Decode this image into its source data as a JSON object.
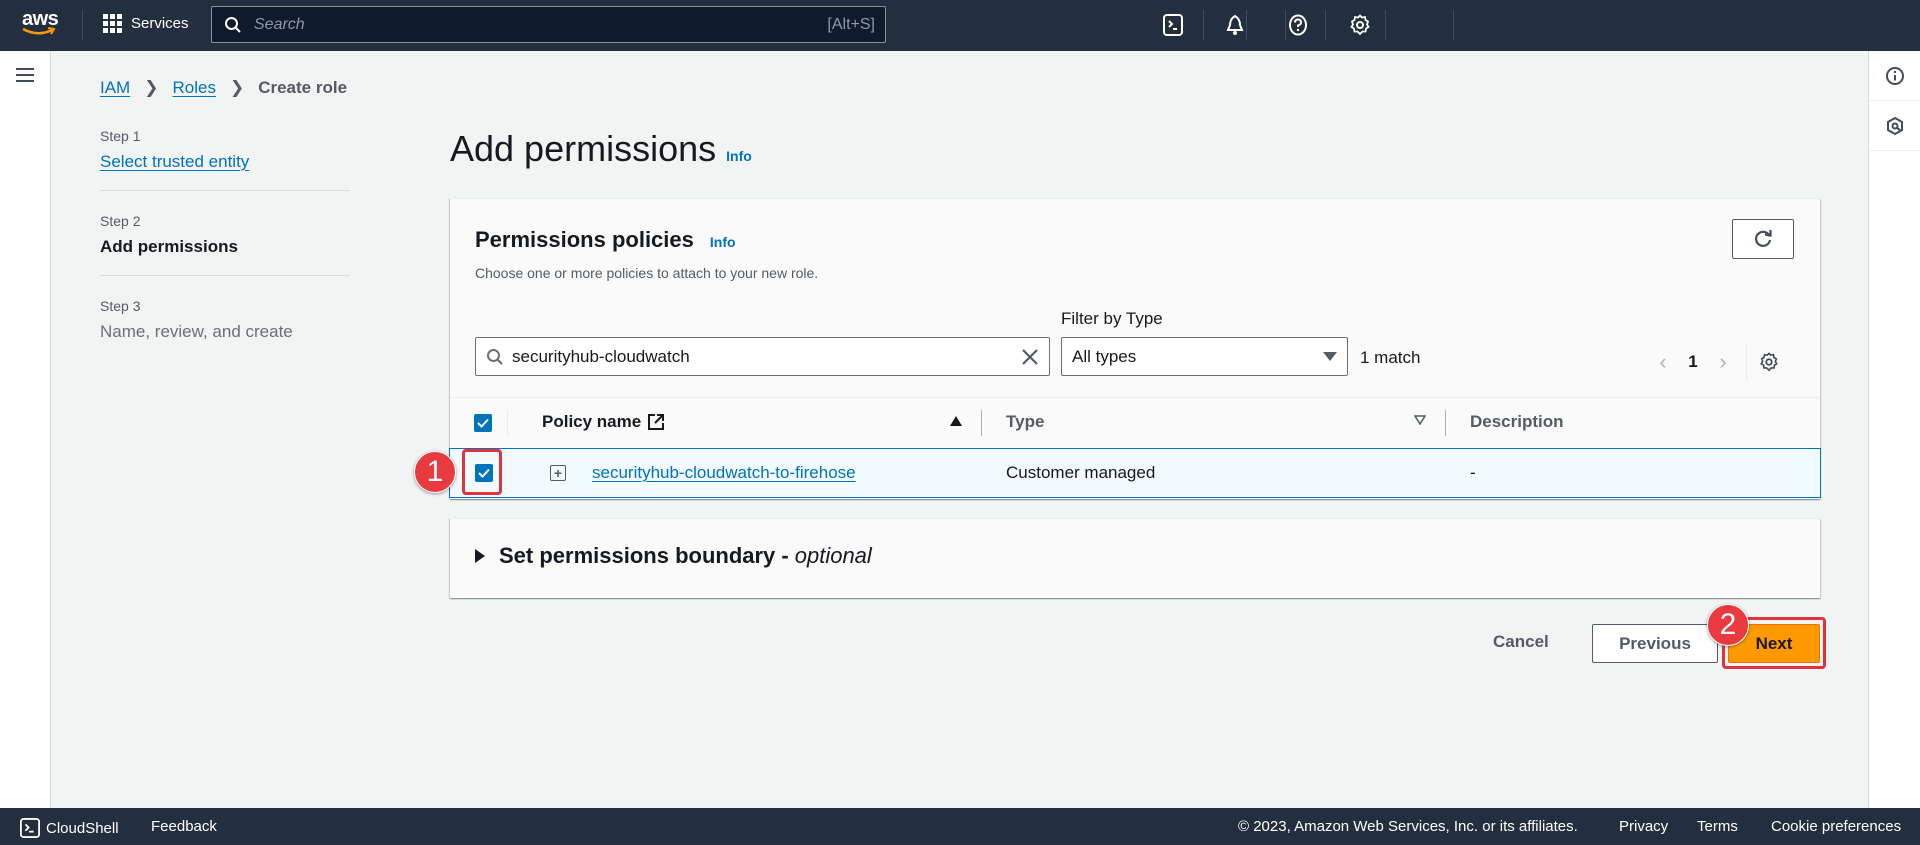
{
  "topnav": {
    "logo_text": "aws",
    "services_label": "Services",
    "search_placeholder": "Search",
    "search_shortcut": "[Alt+S]",
    "icons": [
      "cloudshell-icon",
      "notifications-bell-icon",
      "help-icon",
      "settings-gear-icon"
    ]
  },
  "breadcrumb": [
    {
      "label": "IAM",
      "link": true
    },
    {
      "label": "Roles",
      "link": true
    },
    {
      "label": "Create role",
      "link": false
    }
  ],
  "steps": [
    {
      "number": "Step 1",
      "label": "Select trusted entity",
      "state": "link"
    },
    {
      "number": "Step 2",
      "label": "Add permissions",
      "state": "active"
    },
    {
      "number": "Step 3",
      "label": "Name, review, and create",
      "state": "disabled"
    }
  ],
  "main": {
    "title": "Add permissions",
    "info": "Info"
  },
  "policies": {
    "title": "Permissions policies",
    "info": "Info",
    "description": "Choose one or more policies to attach to your new role.",
    "search_value": "securityhub-cloudwatch",
    "filter_label": "Filter by Type",
    "filter_value": "All types",
    "match_count": "1 match",
    "page": "1",
    "columns": [
      "Policy name",
      "Type",
      "Description"
    ],
    "rows": [
      {
        "selected": true,
        "policy_name": "securityhub-cloudwatch-to-firehose",
        "type": "Customer managed",
        "description": "-"
      }
    ]
  },
  "boundary": {
    "title": "Set permissions boundary -",
    "optional": "optional"
  },
  "actions": {
    "cancel": "Cancel",
    "previous": "Previous",
    "next": "Next"
  },
  "annotations": {
    "badge1": "1",
    "badge2": "2",
    "highlight_color": "#e0333b"
  },
  "footer": {
    "cloudshell": "CloudShell",
    "feedback": "Feedback",
    "copyright": "© 2023, Amazon Web Services, Inc. or its affiliates.",
    "privacy": "Privacy",
    "terms": "Terms",
    "cookie": "Cookie preferences"
  },
  "colors": {
    "nav_bg": "#232f3e",
    "link": "#0073bb",
    "primary_button": "#ff9900",
    "page_bg": "#f2f3f3"
  }
}
